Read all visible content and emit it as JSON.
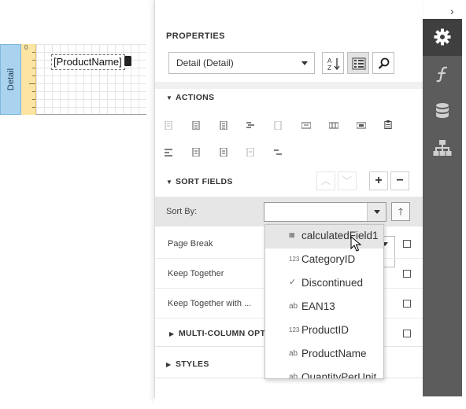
{
  "canvas": {
    "band_label": "Detail",
    "ruler_mark": "0",
    "field_text": "[ProductName]"
  },
  "panel": {
    "title": "PROPERTIES",
    "selected_object": "Detail (Detail)",
    "sections": {
      "actions": "ACTIONS",
      "sort_fields": "SORT FIELDS",
      "multi_column": "MULTI-COLUMN OPTIC",
      "styles": "STYLES"
    },
    "sort_by": {
      "label": "Sort By:",
      "value": ""
    },
    "rows": [
      {
        "label": "Page Break"
      },
      {
        "label": "Keep Together"
      },
      {
        "label": "Keep Together with ..."
      }
    ],
    "toolbar_icons": [
      "sort-alphabetical-icon",
      "categorized-view-icon",
      "search-icon"
    ],
    "sort_buttons": [
      "move-up",
      "move-down",
      "add",
      "remove"
    ]
  },
  "dropdown": {
    "items": [
      {
        "icon": "calculated-field-icon",
        "glyph": "▦",
        "label": "calculatedField1",
        "hover": true
      },
      {
        "icon": "numeric-field-icon",
        "glyph": "123",
        "label": "CategoryID"
      },
      {
        "icon": "boolean-field-icon",
        "glyph": "✓",
        "label": "Discontinued"
      },
      {
        "icon": "string-field-icon",
        "glyph": "ab",
        "label": "EAN13"
      },
      {
        "icon": "numeric-field-icon",
        "glyph": "123",
        "label": "ProductID"
      },
      {
        "icon": "string-field-icon",
        "glyph": "ab",
        "label": "ProductName"
      },
      {
        "icon": "string-field-icon",
        "glyph": "ab",
        "label": "QuantityPerUnit"
      }
    ]
  },
  "rail": {
    "tabs": [
      "properties-tab",
      "expressions-tab",
      "field-list-tab",
      "report-explorer-tab"
    ],
    "active": "properties-tab"
  },
  "colors": {
    "band_tab": "#a9d3ee",
    "ruler": "#fce5a3",
    "rail": "#5c5c5c",
    "rail_active": "#3f3f3f"
  }
}
